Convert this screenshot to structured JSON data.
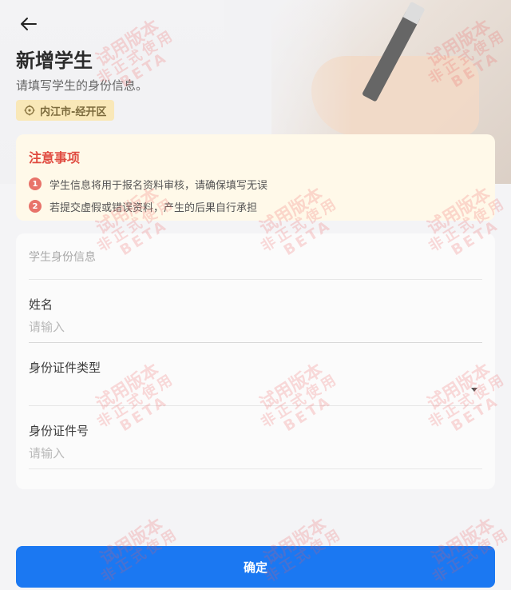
{
  "header": {
    "title": "新增学生",
    "subtitle": "请填写学生的身份信息。",
    "location": "内江市-经开区"
  },
  "notice": {
    "title": "注意事项",
    "items": [
      {
        "num": "1",
        "text": "学生信息将用于报名资料审核，请确保填写无误"
      },
      {
        "num": "2",
        "text": "若提交虚假或错误资料，产生的后果自行承担"
      }
    ]
  },
  "form": {
    "section_title": "学生身份信息",
    "name": {
      "label": "姓名",
      "placeholder": "请输入",
      "value": ""
    },
    "id_type": {
      "label": "身份证件类型",
      "value": ""
    },
    "id_number": {
      "label": "身份证件号",
      "placeholder": "请输入",
      "value": ""
    }
  },
  "actions": {
    "confirm_label": "确定"
  },
  "watermark": {
    "line1": "试用版本",
    "line2": "非正式使用",
    "line3": "BETA"
  },
  "colors": {
    "accent": "#1b78f2",
    "notice_title": "#e04b40",
    "notice_bg": "#fff9e9",
    "tag_bg": "#f9e8b8"
  }
}
